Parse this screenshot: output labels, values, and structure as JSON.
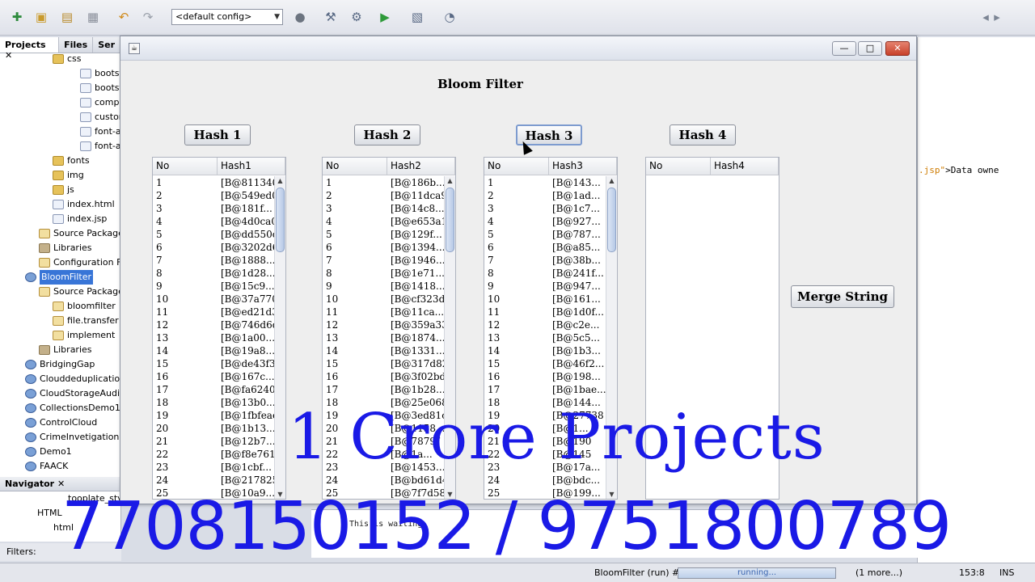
{
  "ide": {
    "config": "<default config>",
    "panel_tabs": [
      "Projects",
      "Files",
      "Ser"
    ],
    "tree": [
      {
        "label": "css",
        "icon": "folder",
        "indent": 3
      },
      {
        "label": "bootstrap",
        "icon": "file",
        "indent": 5
      },
      {
        "label": "bootstrap",
        "icon": "file",
        "indent": 5
      },
      {
        "label": "compone",
        "icon": "file",
        "indent": 5
      },
      {
        "label": "custom-s",
        "icon": "file",
        "indent": 5
      },
      {
        "label": "font-awe",
        "icon": "file",
        "indent": 5
      },
      {
        "label": "font-awe",
        "icon": "file",
        "indent": 5
      },
      {
        "label": "fonts",
        "icon": "folder",
        "indent": 3
      },
      {
        "label": "img",
        "icon": "folder",
        "indent": 3
      },
      {
        "label": "js",
        "icon": "folder",
        "indent": 3
      },
      {
        "label": "index.html",
        "icon": "file",
        "indent": 3
      },
      {
        "label": "index.jsp",
        "icon": "file",
        "indent": 3
      },
      {
        "label": "Source Packages",
        "icon": "pkg",
        "indent": 2
      },
      {
        "label": "Libraries",
        "icon": "lib",
        "indent": 2
      },
      {
        "label": "Configuration Files",
        "icon": "pkg",
        "indent": 2
      },
      {
        "label": "BloomFilter",
        "icon": "proj",
        "indent": 1,
        "selected": true
      },
      {
        "label": "Source Packages",
        "icon": "pkg",
        "indent": 2
      },
      {
        "label": "bloomfilter",
        "icon": "pkg",
        "indent": 3
      },
      {
        "label": "file.transfer",
        "icon": "pkg",
        "indent": 3
      },
      {
        "label": "implement",
        "icon": "pkg",
        "indent": 3
      },
      {
        "label": "Libraries",
        "icon": "lib",
        "indent": 2
      },
      {
        "label": "BridgingGap",
        "icon": "proj",
        "indent": 1
      },
      {
        "label": "Clouddeduplication",
        "icon": "proj",
        "indent": 1
      },
      {
        "label": "CloudStorageAuditKey",
        "icon": "proj",
        "indent": 1
      },
      {
        "label": "CollectionsDemo1",
        "icon": "proj",
        "indent": 1
      },
      {
        "label": "ControlCloud",
        "icon": "proj",
        "indent": 1
      },
      {
        "label": "CrimeInvetigationSystem",
        "icon": "proj",
        "indent": 1
      },
      {
        "label": "Demo1",
        "icon": "proj",
        "indent": 1
      },
      {
        "label": "FAACK",
        "icon": "proj",
        "indent": 1
      }
    ],
    "navigator": {
      "title": "Navigator",
      "items": [
        "tooplate_sty",
        "HTML",
        "html"
      ]
    },
    "filters_label": "Filters:",
    "editor_snippet": {
      "attr": ".jsp\"",
      "text": ">Data owne"
    },
    "output_text": "This is waiting",
    "status": {
      "task": "BloomFilter (run) #2",
      "progress": "running...",
      "more": "(1 more...)",
      "position": "153:8",
      "mode": "INS"
    }
  },
  "app": {
    "title": "Bloom Filter",
    "merge_label": "Merge String",
    "hashes": [
      {
        "button": "Hash 1",
        "col_no": "No",
        "col_hash": "Hash1",
        "rows": [
          "[B@811340",
          "[B@549ed0",
          "[B@181f...",
          "[B@4d0ca0",
          "[B@dd550c",
          "[B@3202d6",
          "[B@1888...",
          "[B@1d28...",
          "[B@15c9...",
          "[B@37a770",
          "[B@ed21d3",
          "[B@746d6d",
          "[B@1a00...",
          "[B@19a8...",
          "[B@de43f3",
          "[B@167c...",
          "[B@fa6240",
          "[B@13b0...",
          "[B@1fbfeae",
          "[B@1b13...",
          "[B@12b7...",
          "[B@f8e761",
          "[B@1cbf...",
          "[B@217825",
          "[B@10a9..."
        ]
      },
      {
        "button": "Hash 2",
        "col_no": "No",
        "col_hash": "Hash2",
        "rows": [
          "[B@186b...",
          "[B@11dca9",
          "[B@14c8...",
          "[B@e653a1",
          "[B@129f...",
          "[B@1394...",
          "[B@1946...",
          "[B@1e71...",
          "[B@1418...",
          "[B@cf323d",
          "[B@11ca...",
          "[B@359a33",
          "[B@1874...",
          "[B@1331...",
          "[B@317d82",
          "[B@3f02bd",
          "[B@1b28...",
          "[B@25e068",
          "[B@3ed81c",
          "[B@1158...",
          "[B@7879f",
          "[B@1a...",
          "[B@1453...",
          "[B@bd61d4",
          "[B@7f7d58"
        ]
      },
      {
        "button": "Hash 3",
        "col_no": "No",
        "col_hash": "Hash3",
        "rows": [
          "[B@143...",
          "[B@1ad...",
          "[B@1c7...",
          "[B@927...",
          "[B@787...",
          "[B@a85...",
          "[B@38b...",
          "[B@241f...",
          "[B@947...",
          "[B@161...",
          "[B@1d0f...",
          "[B@c2e...",
          "[B@5c5...",
          "[B@1b3...",
          "[B@46f2...",
          "[B@198...",
          "[B@1bae...",
          "[B@144...",
          "[B@27738",
          "[B@1...",
          "[B@190",
          "[B@145",
          "[B@17a...",
          "[B@bdc...",
          "[B@199..."
        ]
      },
      {
        "button": "Hash 4",
        "col_no": "No",
        "col_hash": "Hash4",
        "rows": []
      }
    ]
  },
  "watermark": {
    "line1": "1 Crore Projects",
    "line2": "7708150152 / 9751800789"
  }
}
